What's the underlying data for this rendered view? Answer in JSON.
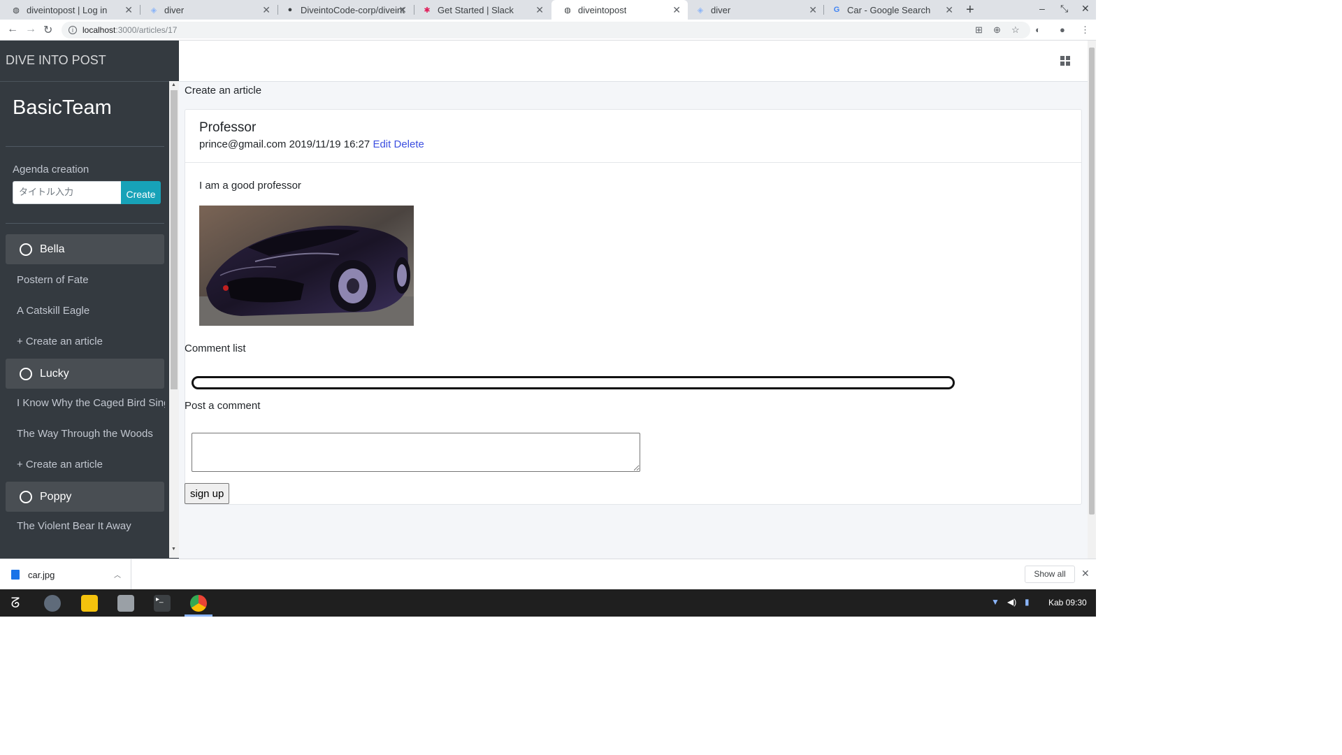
{
  "browser": {
    "tabs": [
      {
        "title": "diveintopost | Log in",
        "icon": "globe-icon",
        "active": false
      },
      {
        "title": "diver",
        "icon": "shield-icon",
        "active": false
      },
      {
        "title": "DiveintoCode-corp/diveint",
        "icon": "github-icon",
        "active": false
      },
      {
        "title": "Get Started | Slack",
        "icon": "slack-icon",
        "active": false
      },
      {
        "title": "diveintopost",
        "icon": "globe-icon",
        "active": true
      },
      {
        "title": "diver",
        "icon": "shield-icon",
        "active": false
      },
      {
        "title": "Car - Google Search",
        "icon": "google-icon",
        "active": false
      }
    ],
    "url_host": "localhost",
    "url_path": ":3000/articles/17"
  },
  "sidebar": {
    "brand": "DIVE INTO POST",
    "team_name": "BasicTeam",
    "agenda_label": "Agenda creation",
    "agenda_placeholder": "タイトル入力",
    "agenda_button": "Create",
    "agendas": [
      {
        "title": "Bella",
        "articles": [
          "Postern of Fate",
          "A Catskill Eagle"
        ],
        "create_link": "+ Create an article"
      },
      {
        "title": "Lucky",
        "articles": [
          "I Know Why the Caged Bird Sings",
          "The Way Through the Woods"
        ],
        "create_link": "+ Create an article"
      },
      {
        "title": "Poppy",
        "articles": [
          "The Violent Bear It Away"
        ]
      }
    ]
  },
  "main": {
    "breadcrumb": "Create an article",
    "article": {
      "title": "Professor",
      "author": "prince@gmail.com",
      "datetime": "2019/11/19 16:27",
      "edit_label": "Edit",
      "delete_label": "Delete",
      "body": "I am a good professor"
    },
    "comment_list_label": "Comment list",
    "post_comment_label": "Post a comment",
    "submit_button": "sign up"
  },
  "download_bar": {
    "file_name": "car.jpg",
    "show_all": "Show all"
  },
  "taskbar": {
    "clock": "Kab 09:30"
  },
  "colors": {
    "sidebar_bg": "#343a40",
    "accent_button": "#17a2b8",
    "link": "#3c4fe0",
    "main_bg": "#f4f6f9"
  }
}
